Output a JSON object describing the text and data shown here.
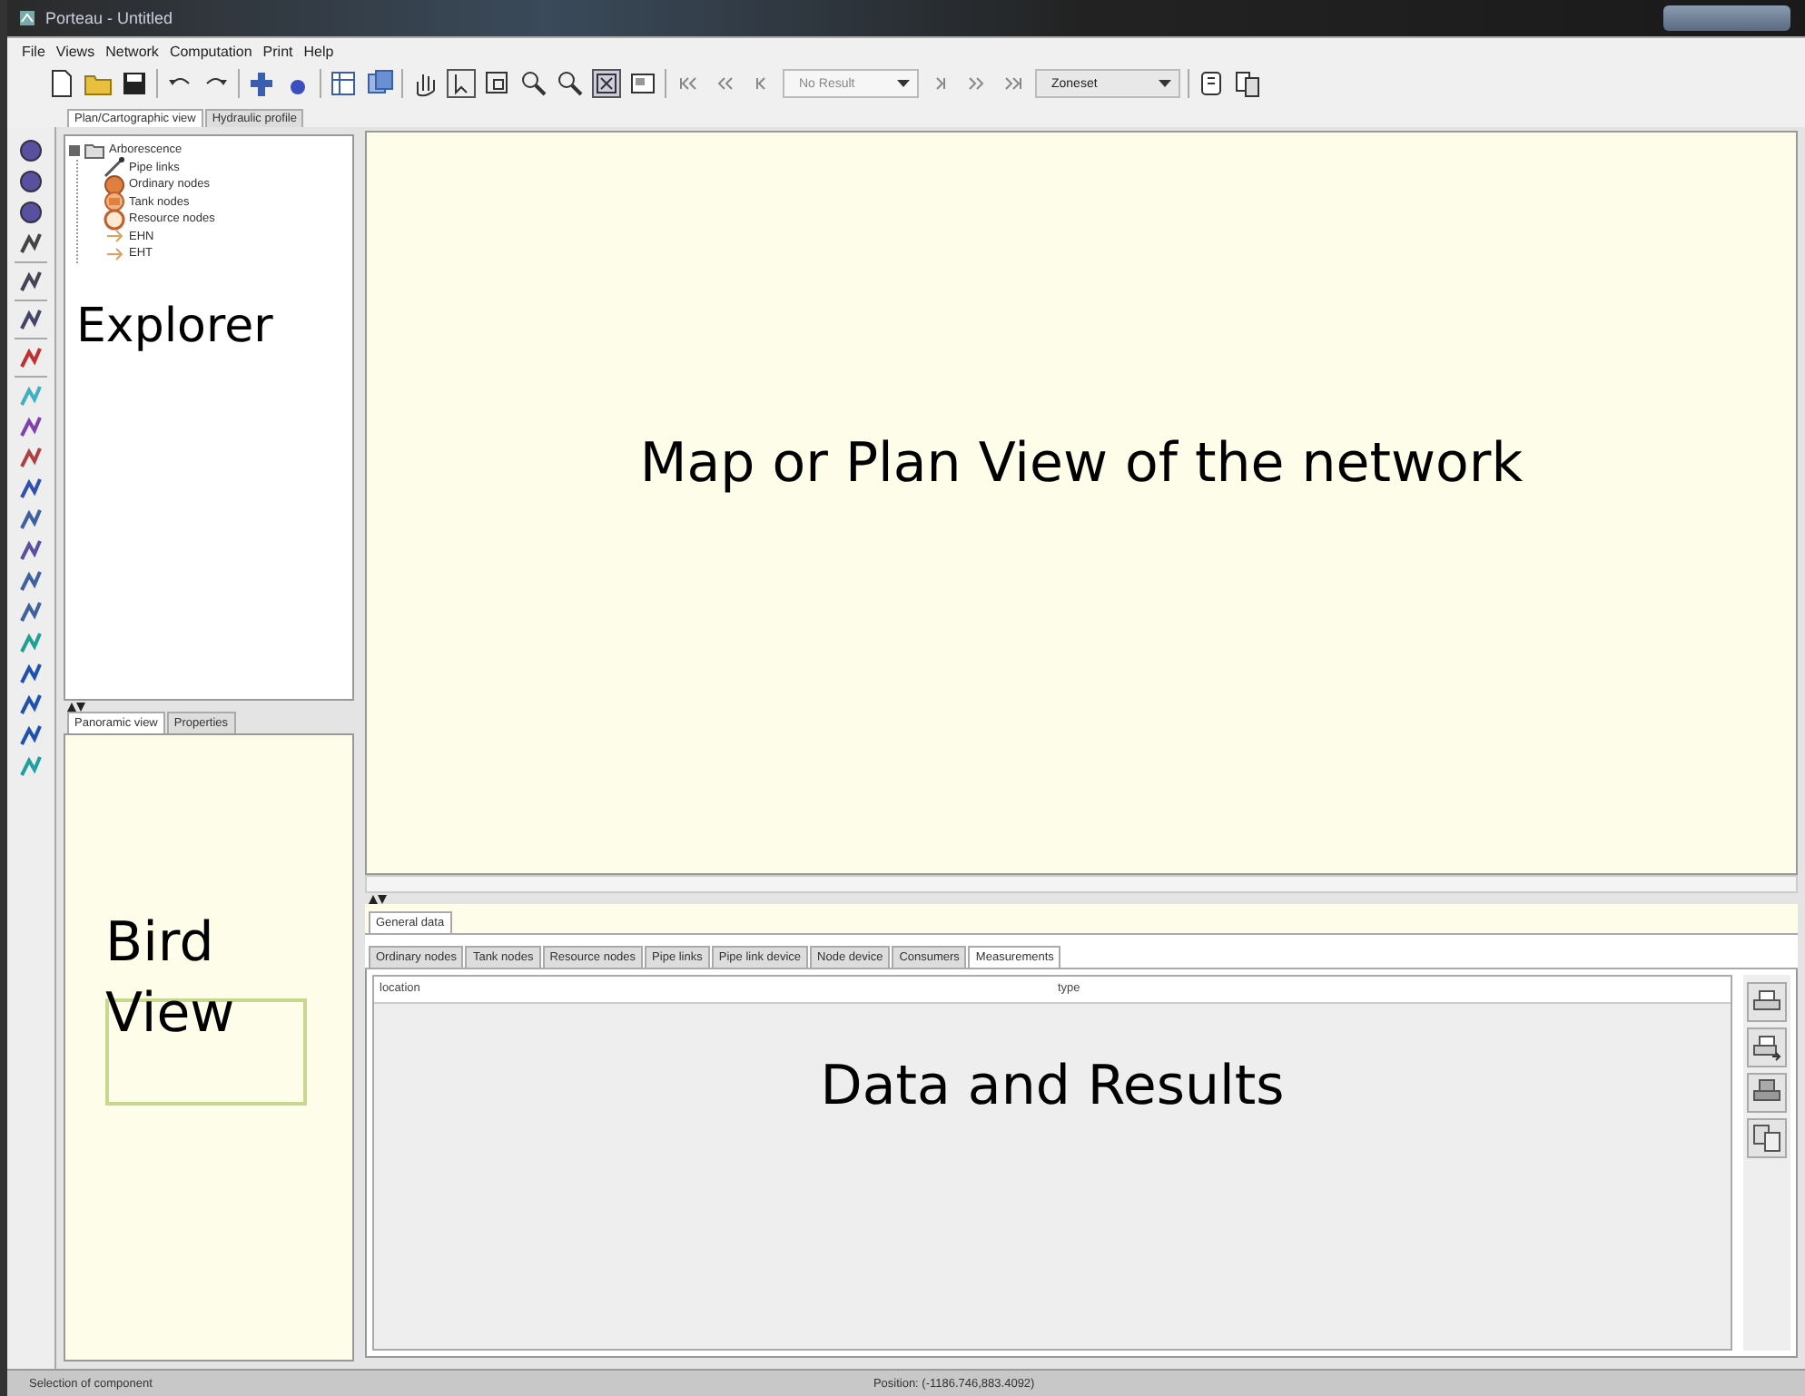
{
  "window": {
    "title": "Porteau - Untitled"
  },
  "menu": [
    "File",
    "Views",
    "Network",
    "Computation",
    "Print",
    "Help"
  ],
  "toolbar": {
    "result_combo": {
      "value": "No Result"
    },
    "zone_combo": {
      "value": "Zoneset"
    }
  },
  "view_tabs": [
    {
      "label": "Plan/Cartographic view",
      "selected": true
    },
    {
      "label": "Hydraulic profile",
      "selected": false
    }
  ],
  "explorer": {
    "tree": [
      {
        "label": "Arborescence",
        "kind": "root",
        "expanded": true,
        "children": [
          {
            "label": "Pipe links",
            "kind": "link"
          },
          {
            "label": "Ordinary nodes",
            "kind": "node"
          },
          {
            "label": "Tank nodes",
            "kind": "tank"
          },
          {
            "label": "Resource nodes",
            "kind": "resource"
          },
          {
            "label": "EHN",
            "kind": "marker"
          },
          {
            "label": "EHT",
            "kind": "marker"
          }
        ]
      }
    ],
    "annotation": "Explorer"
  },
  "bird_panel": {
    "tabs": [
      {
        "label": "Panoramic view",
        "selected": true
      },
      {
        "label": "Properties",
        "selected": false
      }
    ],
    "annotation": "Bird View"
  },
  "map": {
    "annotation": "Map or Plan View of the network"
  },
  "data_panel": {
    "outer_tabs": [
      {
        "label": "General data",
        "selected": true
      }
    ],
    "tabs": [
      {
        "label": "Ordinary nodes",
        "selected": false
      },
      {
        "label": "Tank nodes",
        "selected": false
      },
      {
        "label": "Resource nodes",
        "selected": false
      },
      {
        "label": "Pipe links",
        "selected": false
      },
      {
        "label": "Pipe link device",
        "selected": false
      },
      {
        "label": "Node device",
        "selected": false
      },
      {
        "label": "Consumers",
        "selected": false
      },
      {
        "label": "Measurements",
        "selected": true
      }
    ],
    "columns": [
      "location",
      "type"
    ],
    "annotation": "Data and Results"
  },
  "status_bar": {
    "message": "Selection of component",
    "position": "Position: (-1186.746,883.4092)"
  }
}
